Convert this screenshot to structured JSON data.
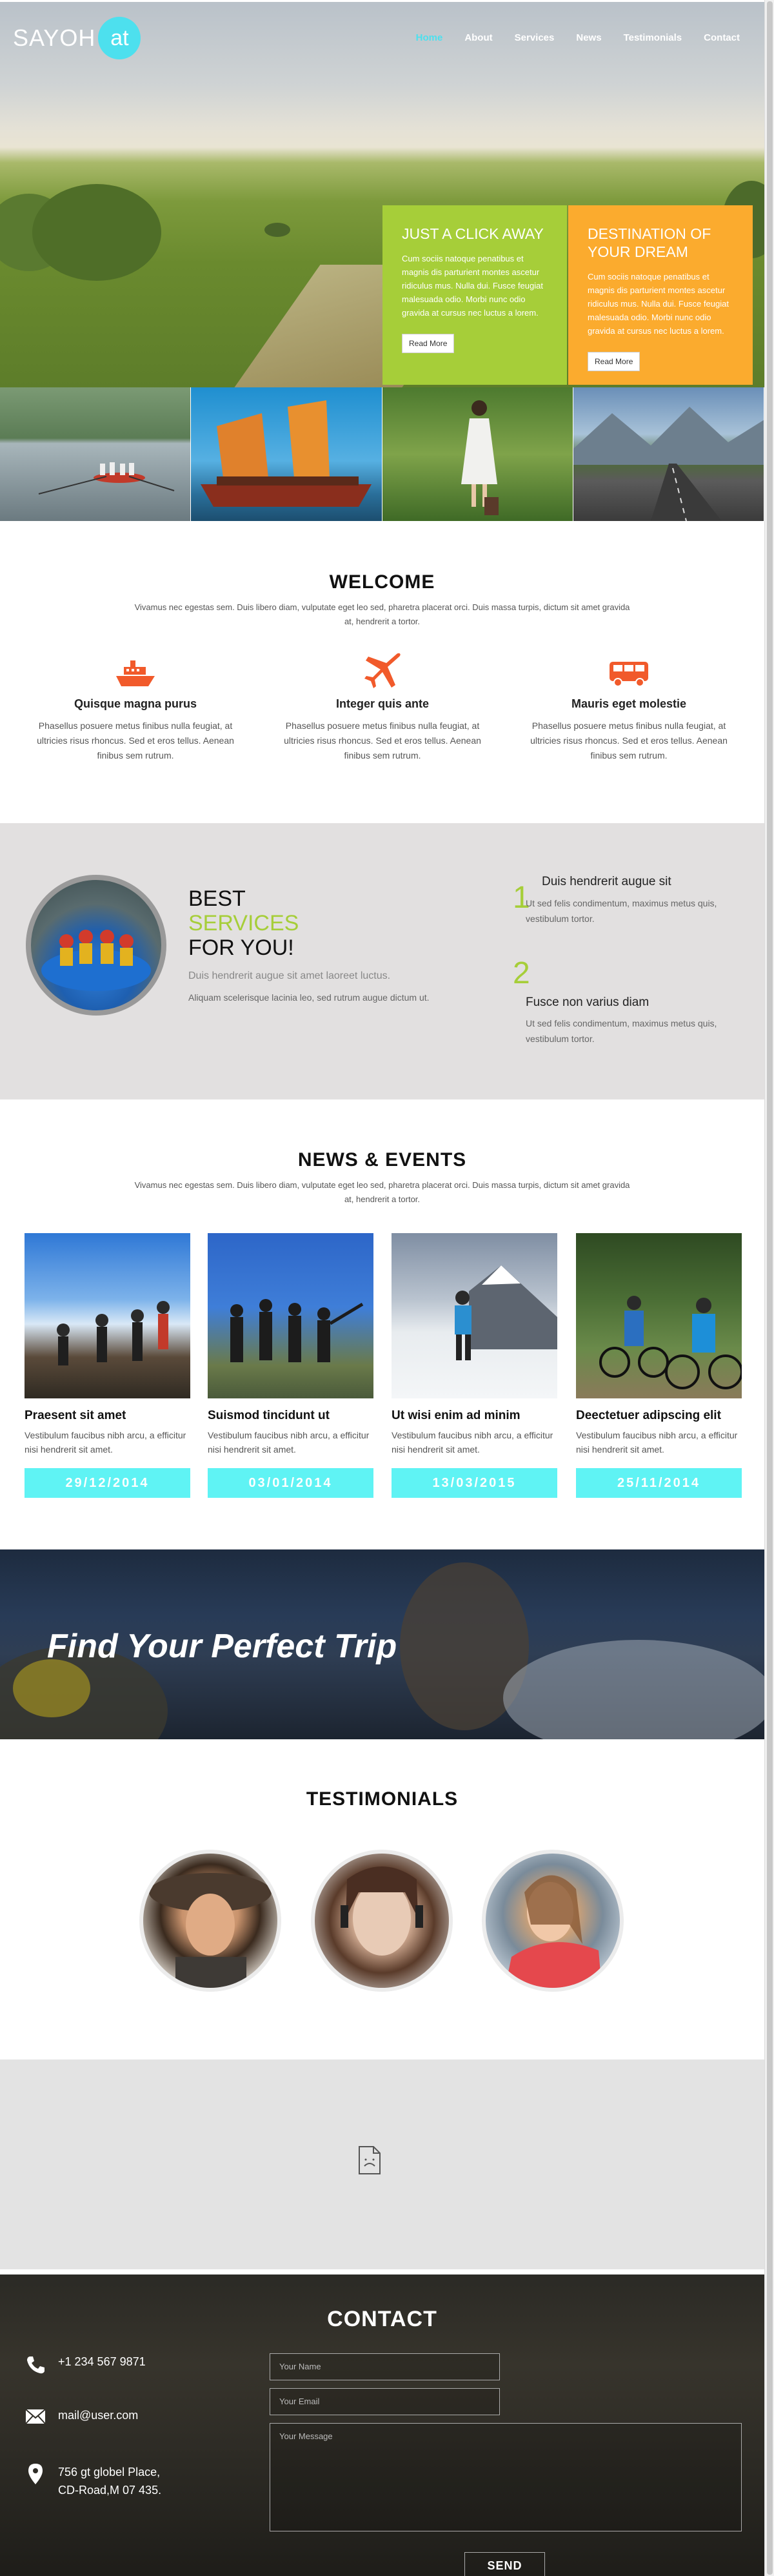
{
  "header": {
    "logo_text": "SAYOH",
    "logo_badge": "at",
    "nav": [
      {
        "label": "Home",
        "active": true
      },
      {
        "label": "About"
      },
      {
        "label": "Services"
      },
      {
        "label": "News"
      },
      {
        "label": "Testimonials"
      },
      {
        "label": "Contact"
      }
    ]
  },
  "promos": [
    {
      "title": "JUST A CLICK AWAY",
      "text": "Cum sociis natoque penatibus et magnis dis parturient montes ascetur ridiculus mus. Nulla dui. Fusce feugiat malesuada odio. Morbi nunc odio gravida at cursus nec luctus a lorem.",
      "button": "Read More",
      "color": "#a6ce39"
    },
    {
      "title": "DESTINATION OF YOUR DREAM",
      "text": "Cum sociis natoque penatibus et magnis dis parturient montes ascetur ridiculus mus. Nulla dui. Fusce feugiat malesuada odio. Morbi nunc odio gravida at cursus nec luctus a lorem.",
      "button": "Read More",
      "color": "#fbab2e"
    }
  ],
  "welcome": {
    "title": "WELCOME",
    "subtitle": "Vivamus nec egestas sem. Duis libero diam, vulputate eget leo sed, pharetra placerat orci. Duis massa turpis, dictum sit amet gravida at, hendrerit a tortor.",
    "features": [
      {
        "icon": "ship-icon",
        "title": "Quisque magna purus",
        "text": "Phasellus posuere metus finibus nulla feugiat, at ultricies risus rhoncus. Sed et eros tellus. Aenean finibus sem rutrum."
      },
      {
        "icon": "airplane-icon",
        "title": "Integer quis ante",
        "text": "Phasellus posuere metus finibus nulla feugiat, at ultricies risus rhoncus. Sed et eros tellus. Aenean finibus sem rutrum."
      },
      {
        "icon": "bus-icon",
        "title": "Mauris eget molestie",
        "text": "Phasellus posuere metus finibus nulla feugiat, at ultricies risus rhoncus. Sed et eros tellus. Aenean finibus sem rutrum."
      }
    ]
  },
  "services": {
    "line1": "BEST",
    "line2": "SERVICES",
    "line3": "FOR YOU!",
    "lead": "Duis hendrerit augue sit amet laoreet luctus.",
    "lead2": "Aliquam scelerisque lacinia leo, sed rutrum augue dictum ut.",
    "items": [
      {
        "num": "1",
        "title": "Duis hendrerit augue sit",
        "text": "Ut sed felis condimentum, maximus metus quis, vestibulum tortor."
      },
      {
        "num": "2",
        "title": "Fusce non varius diam",
        "text": "Ut sed felis condimentum, maximus metus quis, vestibulum tortor."
      }
    ]
  },
  "news": {
    "title": "NEWS & EVENTS",
    "subtitle": "Vivamus nec egestas sem. Duis libero diam, vulputate eget leo sed, pharetra placerat orci. Duis massa turpis, dictum sit amet gravida at, hendrerit a tortor.",
    "items": [
      {
        "title": "Praesent sit amet",
        "text": "Vestibulum faucibus nibh arcu, a efficitur nisi hendrerit sit amet.",
        "date": "29/12/2014"
      },
      {
        "title": "Suismod tincidunt ut",
        "text": "Vestibulum faucibus nibh arcu, a efficitur nisi hendrerit sit amet.",
        "date": "03/01/2014"
      },
      {
        "title": "Ut wisi enim ad minim",
        "text": "Vestibulum faucibus nibh arcu, a efficitur nisi hendrerit sit amet.",
        "date": "13/03/2015"
      },
      {
        "title": "Deectetuer adipscing elit",
        "text": "Vestibulum faucibus nibh arcu, a efficitur nisi hendrerit sit amet.",
        "date": "25/11/2014"
      }
    ]
  },
  "banner": {
    "text": "Find Your Perfect Trip"
  },
  "testimonials": {
    "title": "TESTIMONIALS"
  },
  "map": {
    "icon": "broken-document-icon"
  },
  "contact": {
    "title": "CONTACT",
    "phone": "+1 234 567 9871",
    "email": "mail@user.com",
    "address_line1": "756 gt globel Place,",
    "address_line2": "CD-Road,M 07 435.",
    "name_placeholder": "Your Name",
    "email_placeholder": "Your Email",
    "message_placeholder": "Your Message",
    "send": "SEND"
  },
  "colors": {
    "accent": "#4de0ee",
    "green": "#a6ce39",
    "orange": "#fbab2e",
    "date_bg": "#5ff3f4",
    "icon_red": "#f15a2b"
  }
}
